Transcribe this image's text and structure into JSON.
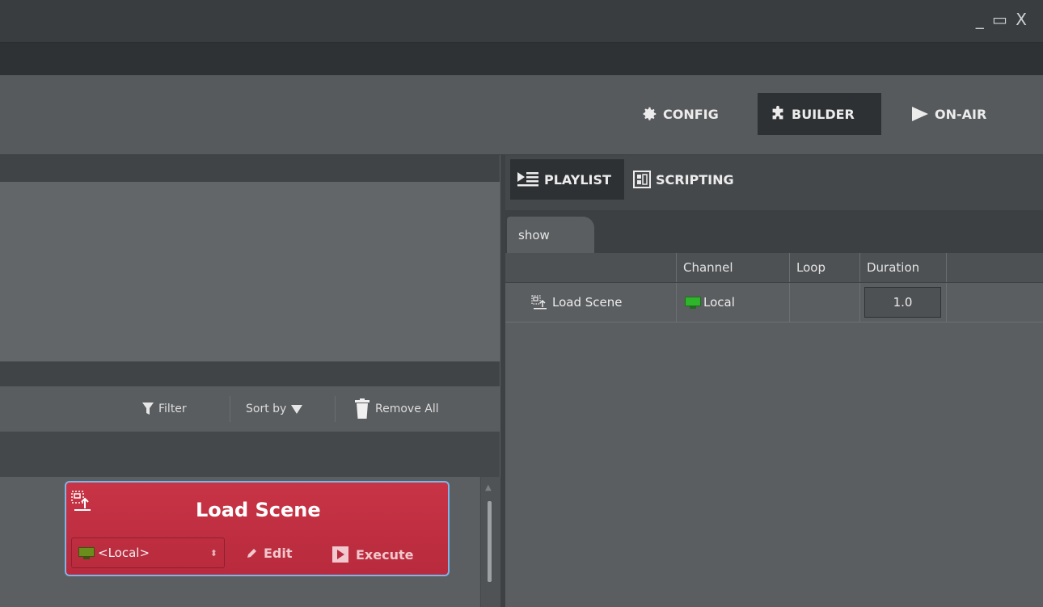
{
  "window": {
    "controls": "_ ▭ X"
  },
  "modes": {
    "config": {
      "label": "CONFIG",
      "icon": "gear-icon"
    },
    "builder": {
      "label": "BUILDER",
      "icon": "puzzle-icon",
      "active": true
    },
    "onair": {
      "label": "ON-AIR",
      "icon": "play-icon"
    }
  },
  "actions_toolbar": {
    "filter": "Filter",
    "sort": "Sort by",
    "remove_all": "Remove All"
  },
  "action_card": {
    "title": "Load Scene",
    "channel": "<Local>",
    "edit": "Edit",
    "execute": "Execute",
    "color": "#c83446"
  },
  "right_panel": {
    "tabs": [
      {
        "label": "PLAYLIST",
        "icon": "playlist-icon",
        "active": true
      },
      {
        "label": "SCRIPTING",
        "icon": "scripting-icon"
      }
    ],
    "doc_tab": "show",
    "columns": [
      "Channel",
      "Loop",
      "Duration"
    ],
    "rows": [
      {
        "action": "Load Scene",
        "channel": "Local",
        "loop": "",
        "duration": "1.0"
      }
    ]
  }
}
